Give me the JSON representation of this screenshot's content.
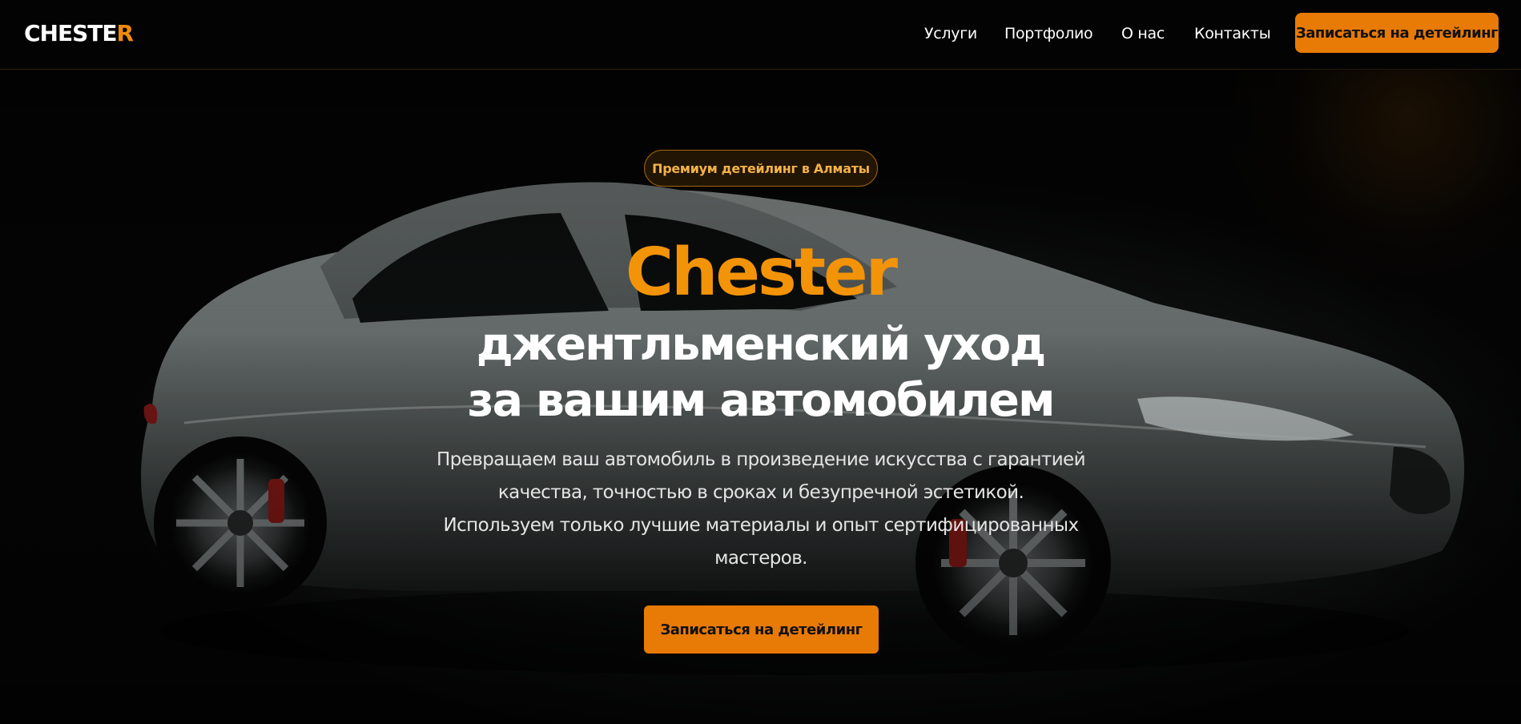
{
  "brand": {
    "logo_main": "CHESTE",
    "logo_accent": "R",
    "accent_color": "#f08a0c"
  },
  "nav": {
    "links": [
      {
        "label": "Услуги"
      },
      {
        "label": "Портфолио"
      },
      {
        "label": "О нас"
      },
      {
        "label": "Контакты"
      }
    ],
    "cta_label": "Записаться на детейлинг"
  },
  "hero": {
    "background_image": "silver-sports-car-icon",
    "badge": "Премиум детейлинг в Алматы",
    "title_accent": "Chester",
    "title_lines": [
      "джентльменский уход",
      "за вашим автомобилем"
    ],
    "description_lines": [
      "Превращаем ваш автомобиль в произведение искусства с гарантией",
      "качества, точностью в сроках и безупречной эстетикой.",
      "Используем только лучшие материалы и опыт сертифицированных",
      "мастеров."
    ],
    "cta_label": "Записаться на детейлинг"
  }
}
